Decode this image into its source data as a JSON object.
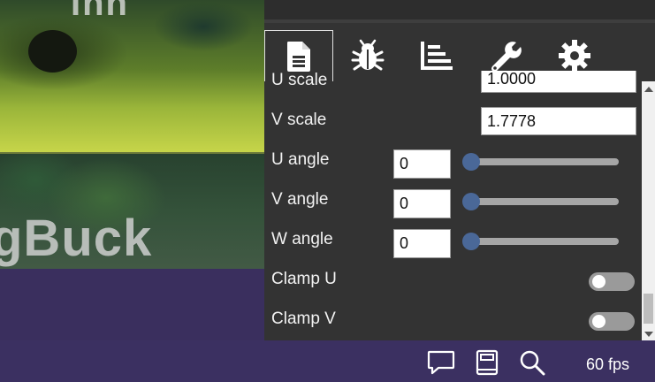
{
  "scene": {
    "title_top": "Inn",
    "title_bottom": "gBuck"
  },
  "tabs": [
    {
      "name": "document-icon",
      "active": true
    },
    {
      "name": "bug-icon",
      "active": false
    },
    {
      "name": "stats-icon",
      "active": false
    },
    {
      "name": "wrench-icon",
      "active": false
    },
    {
      "name": "gear-icon",
      "active": false
    }
  ],
  "properties": {
    "u_scale": {
      "label": "U scale",
      "value": "1.0000"
    },
    "v_scale": {
      "label": "V scale",
      "value": "1.7778"
    },
    "u_angle": {
      "label": "U angle",
      "value": "0",
      "slider_fraction": 0
    },
    "v_angle": {
      "label": "V angle",
      "value": "0",
      "slider_fraction": 0
    },
    "w_angle": {
      "label": "W angle",
      "value": "0",
      "slider_fraction": 0
    },
    "clamp_u": {
      "label": "Clamp U",
      "on": false
    },
    "clamp_v": {
      "label": "Clamp V",
      "on": false
    }
  },
  "bottom_bar": {
    "icons": [
      "comment-icon",
      "book-icon",
      "search-icon"
    ],
    "fps": "60 fps"
  },
  "colors": {
    "panel_bg": "#333333",
    "accent": "#4a6898",
    "bottom_bar": "#3b3061"
  }
}
